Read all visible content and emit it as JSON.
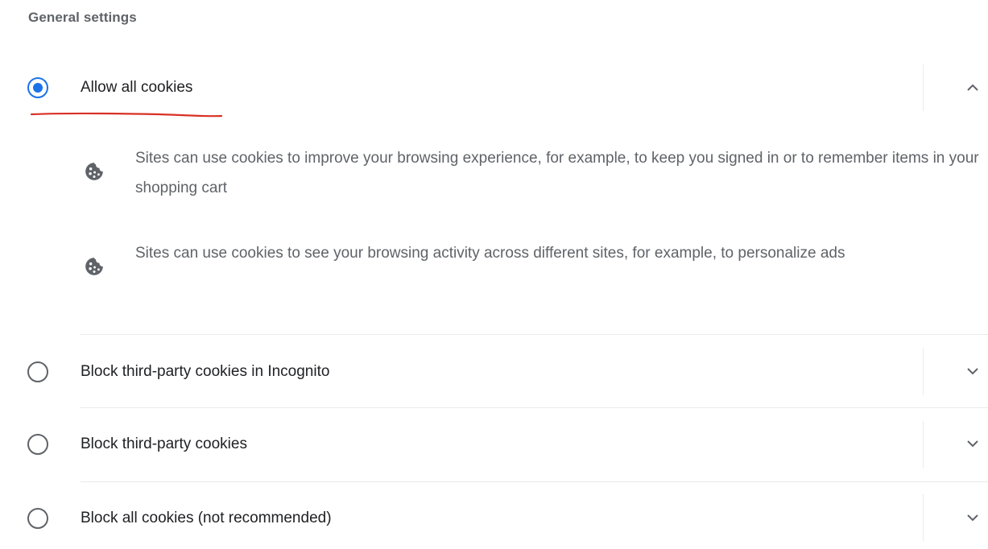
{
  "section": {
    "title": "General settings"
  },
  "options": [
    {
      "label": "Allow all cookies",
      "selected": true,
      "expanded": true,
      "details": [
        {
          "icon": "cookie-icon",
          "text": "Sites can use cookies to improve your browsing experience, for example, to keep you signed in or to remember items in your shopping cart"
        },
        {
          "icon": "cookie-icon",
          "text": "Sites can use cookies to see your browsing activity across different sites, for example, to personalize ads"
        }
      ]
    },
    {
      "label": "Block third-party cookies in Incognito",
      "selected": false,
      "expanded": false
    },
    {
      "label": "Block third-party cookies",
      "selected": false,
      "expanded": false
    },
    {
      "label": "Block all cookies (not recommended)",
      "selected": false,
      "expanded": false
    }
  ],
  "colors": {
    "accent": "#1a73e8",
    "annotation": "#d93025",
    "separator": "#e8eaed"
  }
}
